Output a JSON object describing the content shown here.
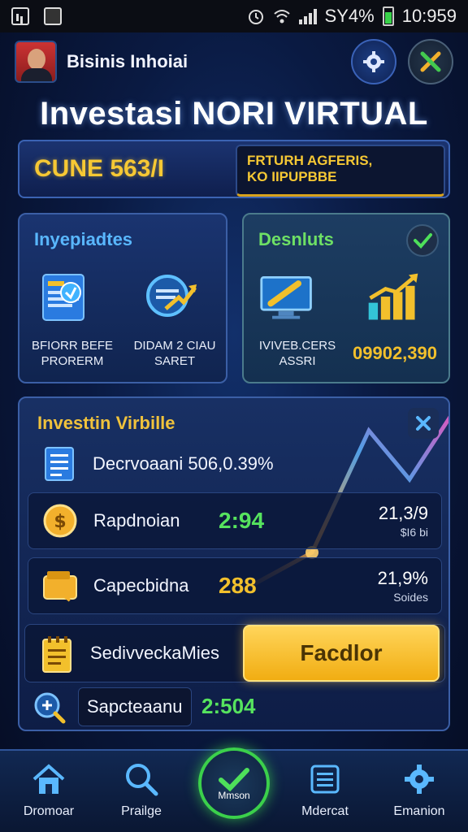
{
  "status_bar": {
    "battery": "SY4%",
    "time": "10:959"
  },
  "header": {
    "app_name": "Bisinis Inhoiai"
  },
  "page_title": "Investasi  NORI VIRTUAL",
  "banner": {
    "main": "CUNE 563/I",
    "sub_line1": "FRTURH AGFERIS,",
    "sub_line2": "KO IIPUPBBE"
  },
  "card_left": {
    "title": "Inyepiadtes",
    "tiles": [
      {
        "label_line1": "BFIORR BEFE",
        "label_line2": "PRORERM"
      },
      {
        "label_line1": "DIDAM 2 CIAU",
        "label_line2": "SARET"
      }
    ]
  },
  "card_right": {
    "title": "Desnluts",
    "tile_label_line1": "IVIVEB.CERS",
    "tile_label_line2": "ASSRI",
    "value": "09902,390"
  },
  "panel": {
    "title": "Investtin Virbille",
    "rows": [
      {
        "label": "Decrvoaani 506,0.39%"
      },
      {
        "label": "Rapdnoian",
        "value": "2:94",
        "right_big": "21,3/9",
        "right_small": "$I6 bi"
      },
      {
        "label": "Capecbidna",
        "value": "288",
        "right_big": "21,9%",
        "right_small": "Soides"
      }
    ],
    "action": {
      "label": "SedivveckaMies",
      "button": "Facdlor"
    },
    "search": {
      "value": "Sapcteaanu",
      "number": "2:504"
    }
  },
  "nav": [
    {
      "label": "Dromoar"
    },
    {
      "label": "Prailge"
    },
    {
      "label": "Mmson"
    },
    {
      "label": "Mdercat"
    },
    {
      "label": "Emanion"
    }
  ],
  "colors": {
    "accent_gold": "#f6c834",
    "accent_green": "#56e35e",
    "accent_blue": "#59b7ff",
    "bg": "#0a1a42"
  }
}
